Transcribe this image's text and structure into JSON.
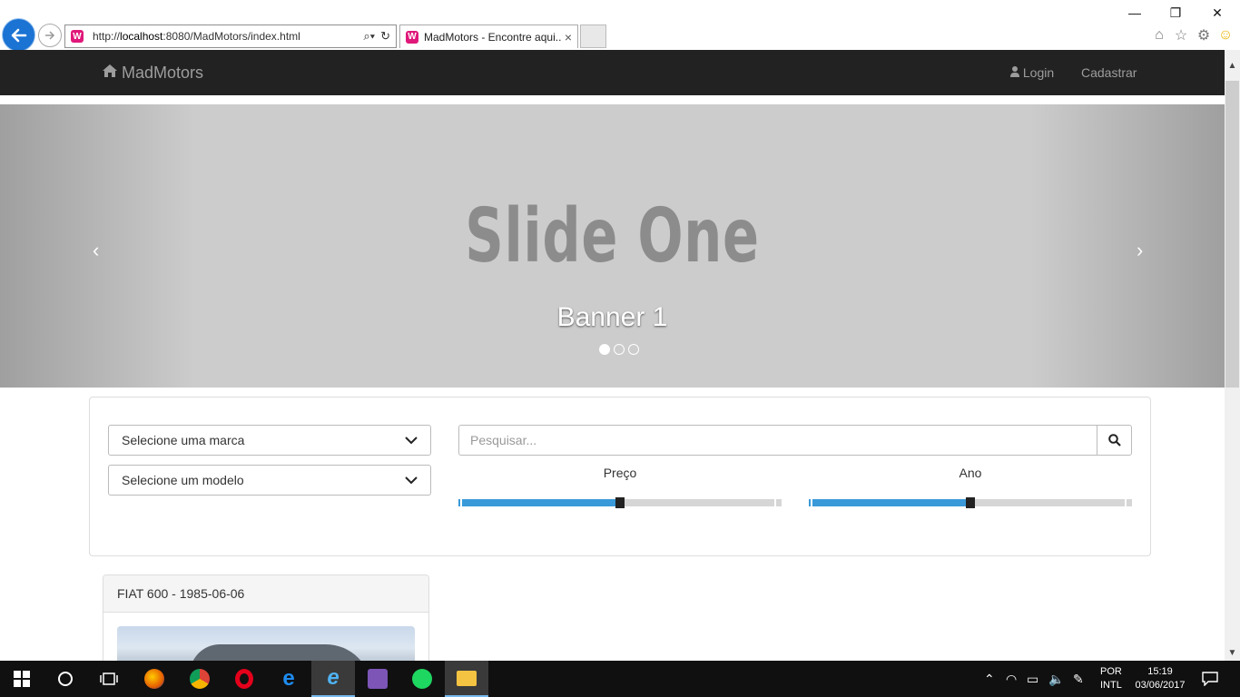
{
  "browser": {
    "url_prefix": "http://",
    "url_host": "localhost",
    "url_rest": ":8080/MadMotors/index.html",
    "tab_title": "MadMotors - Encontre aqui...",
    "tab_close": "×",
    "window": {
      "minimize": "—",
      "restore": "❐",
      "close": "✕"
    },
    "tool_icons": [
      "home-icon",
      "star-icon",
      "gear-icon",
      "smiley-icon"
    ]
  },
  "navbar": {
    "brand": "MadMotors",
    "login": "Login",
    "register": "Cadastrar"
  },
  "carousel": {
    "slide_title": "Slide One",
    "caption": "Banner 1",
    "prev": "‹",
    "next": "›",
    "slide_count": 3,
    "active_index": 0
  },
  "filters": {
    "brand_select": "Selecione uma marca",
    "model_select": "Selecione um modelo",
    "search_placeholder": "Pesquisar...",
    "price_label": "Preço",
    "year_label": "Ano",
    "price_range_fraction": 0.5,
    "year_range_fraction": 0.5
  },
  "listing": {
    "card_title": "FIAT 600 - 1985-06-06"
  },
  "taskbar": {
    "lang_line1": "POR",
    "lang_line2": "INTL",
    "time": "15:19",
    "date": "03/06/2017"
  },
  "colors": {
    "navbar_bg": "#222222",
    "slider_fill": "#3a9ad9",
    "taskbar_bg": "#101010"
  }
}
